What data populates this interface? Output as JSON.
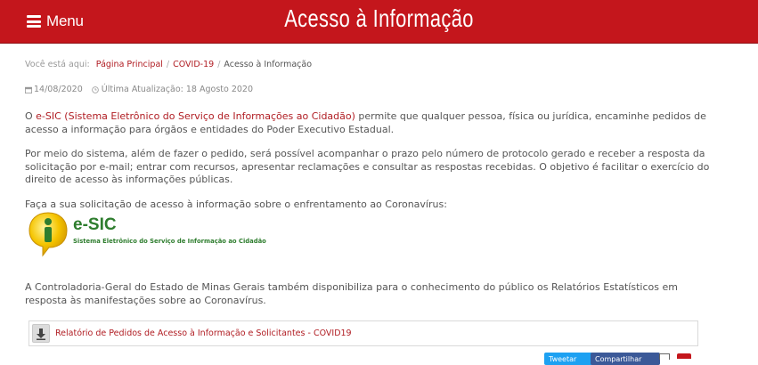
{
  "header": {
    "menu_label": "Menu",
    "title": "Acesso à Informação",
    "bg_color": "#c4161c"
  },
  "breadcrumb": {
    "prefix": "Você está aqui:",
    "items": [
      "Página Principal",
      "COVID-19"
    ],
    "current": "Acesso à Informação"
  },
  "meta": {
    "date": "14/08/2020",
    "updated": "Última Atualização: 18 Agosto 2020"
  },
  "content": {
    "p1_link": "e-SIC (Sistema Eletrônico do Serviço de Informações ao Cidadão)",
    "p1_before": "O ",
    "p1_after": " permite que qualquer pessoa, física ou jurídica, encaminhe pedidos de acesso a informação para órgãos e entidades do Poder Executivo Estadual.",
    "p2": "Por meio do sistema, além de fazer o pedido, será possível acompanhar o prazo pelo número de protocolo gerado e receber a resposta da solicitação por e-mail; entrar com recursos, apresentar reclamações e consultar as respostas recebidas. O objetivo é facilitar o exercício do direito de acesso às informações públicas.",
    "p3": "Faça a sua solicitação de acesso à informação sobre o enfrentamento ao Coronavírus:",
    "p4": "A Controladoria-Geral do Estado de Minas Gerais também disponibiliza para o conhecimento do público os Relatórios Estatísticos em resposta às manifestações sobre ao Coronavírus."
  },
  "logo": {
    "title": "e-SIC",
    "subtitle": "Sistema Eletrônico do Serviço de Informação ao Cidadão",
    "icon": "info-i-icon"
  },
  "download": {
    "label": "Relatório de Pedidos de Acesso à Informação e Solicitantes - COVID19",
    "icon": "download-arrow-icon"
  },
  "share": {
    "twitter": "Tweetar",
    "facebook": "Compartilhar"
  }
}
